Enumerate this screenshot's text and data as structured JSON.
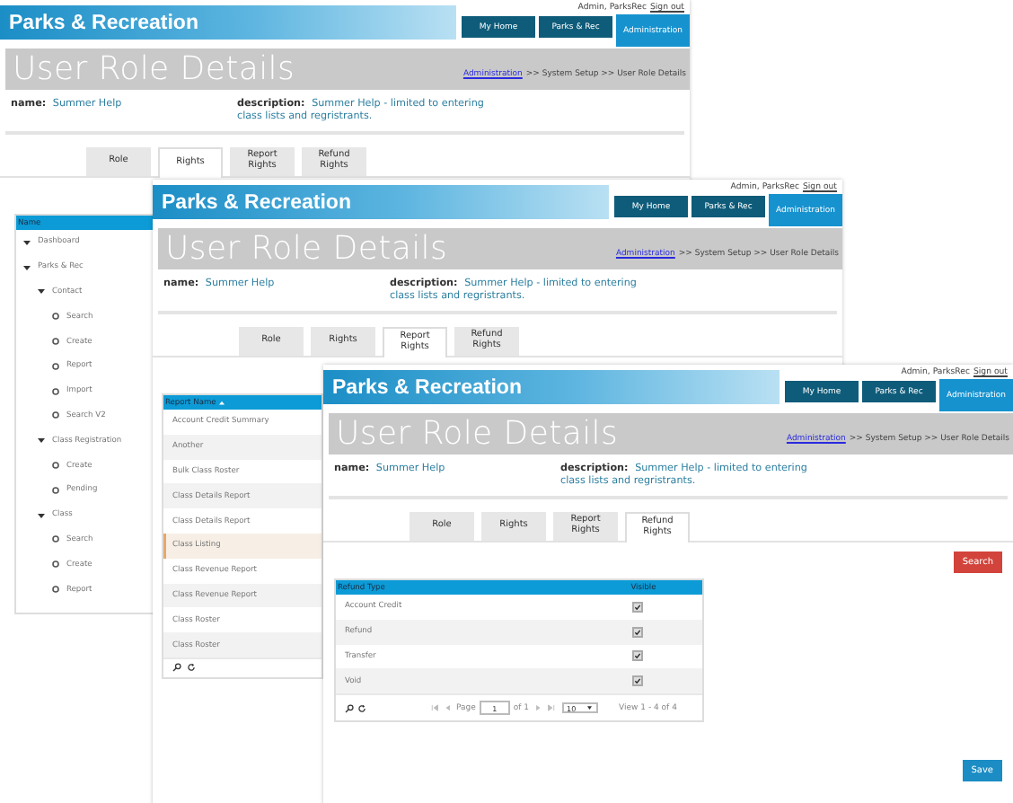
{
  "screens": [
    {
      "kind": "tree",
      "brand": "Parks & Recreation",
      "user": "Admin, ParksRec",
      "sign_out": "Sign out",
      "nav": [
        {
          "label": "My Home",
          "selected": false
        },
        {
          "label": "Parks & Rec",
          "selected": false
        },
        {
          "label": "Administration",
          "selected": true
        }
      ],
      "page_title": "User Role Details",
      "breadcrumb_link": "Administration",
      "breadcrumb_rest": ">> System Setup >> User Role Details",
      "name_label": "name:",
      "name_value": "Summer Help",
      "description_label": "description:",
      "description_value": "Summer Help - limited to entering class lists and regristrants.",
      "tabs": [
        {
          "label": "Role",
          "selected": false
        },
        {
          "label": "Rights",
          "selected": true
        },
        {
          "label": "Report Rights",
          "selected": false
        },
        {
          "label": "Refund Rights",
          "selected": false
        }
      ],
      "column": "Name",
      "items": [
        {
          "label": "Dashboard",
          "kind": "group"
        },
        {
          "label": "Parks & Rec",
          "kind": "group",
          "children": [
            {
              "label": "Contact",
              "kind": "group",
              "children": [
                {
                  "label": "Search",
                  "kind": "leaf"
                },
                {
                  "label": "Create",
                  "kind": "leaf"
                },
                {
                  "label": "Report",
                  "kind": "leaf"
                },
                {
                  "label": "Import",
                  "kind": "leaf"
                },
                {
                  "label": "Search V2",
                  "kind": "leaf"
                }
              ]
            },
            {
              "label": "Class Registration",
              "kind": "group",
              "children": [
                {
                  "label": "Create",
                  "kind": "leaf"
                },
                {
                  "label": "Pending",
                  "kind": "leaf"
                }
              ]
            },
            {
              "label": "Class",
              "kind": "group",
              "children": [
                {
                  "label": "Search",
                  "kind": "leaf"
                },
                {
                  "label": "Create",
                  "kind": "leaf"
                },
                {
                  "label": "Report",
                  "kind": "leaf"
                }
              ]
            }
          ]
        }
      ]
    },
    {
      "kind": "reports",
      "brand": "Parks & Recreation",
      "user": "Admin, ParksRec",
      "sign_out": "Sign out",
      "nav": [
        {
          "label": "My Home",
          "selected": false
        },
        {
          "label": "Parks & Rec",
          "selected": false
        },
        {
          "label": "Administration",
          "selected": true
        }
      ],
      "page_title": "User Role Details",
      "breadcrumb_link": "Administration",
      "breadcrumb_rest": ">> System Setup >> User Role Details",
      "name_label": "name:",
      "name_value": "Summer Help",
      "description_label": "description:",
      "description_value": "Summer Help - limited to entering class lists and regristrants.",
      "tabs": [
        {
          "label": "Role",
          "selected": false
        },
        {
          "label": "Rights",
          "selected": false
        },
        {
          "label": "Report Rights",
          "selected": true
        },
        {
          "label": "Refund Rights",
          "selected": false
        }
      ],
      "column": "Report Name",
      "rows": [
        {
          "label": "Account Credit Summary",
          "selected": false
        },
        {
          "label": "Another",
          "selected": false
        },
        {
          "label": "Bulk Class Roster",
          "selected": false
        },
        {
          "label": "Class Details Report",
          "selected": false
        },
        {
          "label": "Class Details Report",
          "selected": false
        },
        {
          "label": "Class Listing",
          "selected": true
        },
        {
          "label": "Class Revenue Report",
          "selected": false
        },
        {
          "label": "Class Revenue Report",
          "selected": false
        },
        {
          "label": "Class Roster",
          "selected": false
        },
        {
          "label": "Class Roster",
          "selected": false
        }
      ]
    },
    {
      "kind": "refunds",
      "brand": "Parks & Recreation",
      "user": "Admin, ParksRec",
      "sign_out": "Sign out",
      "nav": [
        {
          "label": "My Home",
          "selected": false
        },
        {
          "label": "Parks & Rec",
          "selected": false
        },
        {
          "label": "Administration",
          "selected": true
        }
      ],
      "page_title": "User Role Details",
      "breadcrumb_link": "Administration",
      "breadcrumb_rest": ">> System Setup >> User Role Details",
      "name_label": "name:",
      "name_value": "Summer Help",
      "description_label": "description:",
      "description_value": "Summer Help - limited to entering class lists and regristrants.",
      "tabs": [
        {
          "label": "Role",
          "selected": false
        },
        {
          "label": "Rights",
          "selected": false
        },
        {
          "label": "Report Rights",
          "selected": false
        },
        {
          "label": "Refund Rights",
          "selected": true
        }
      ],
      "search_button": "Search",
      "columns": [
        "Refund Type",
        "Visible"
      ],
      "rows": [
        {
          "label": "Account Credit",
          "visible": true
        },
        {
          "label": "Refund",
          "visible": true
        },
        {
          "label": "Transfer",
          "visible": true
        },
        {
          "label": "Void",
          "visible": true
        }
      ],
      "pager": {
        "page_label": "Page",
        "page": "1",
        "of": "of 1",
        "per_page": "10",
        "summary": "View 1 - 4 of 4"
      },
      "save_button": "Save"
    }
  ]
}
